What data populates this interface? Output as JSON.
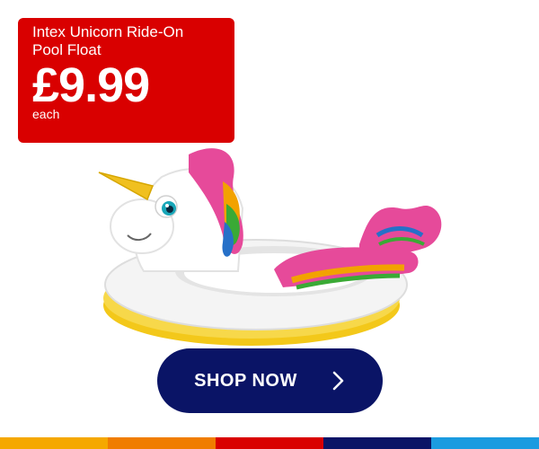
{
  "promo": {
    "product_name": "Intex Unicorn Ride-On Pool Float",
    "price": "£9.99",
    "unit": "each",
    "card_color": "#d90000"
  },
  "product_image": {
    "icon": "unicorn-pool-float-image"
  },
  "cta": {
    "label": "SHOP NOW",
    "icon": "chevron-right-icon",
    "color": "#0a1466"
  },
  "brand_stripe": {
    "colors": [
      "#f5a800",
      "#f07d00",
      "#d90000",
      "#0a1466",
      "#1b9be0"
    ]
  }
}
